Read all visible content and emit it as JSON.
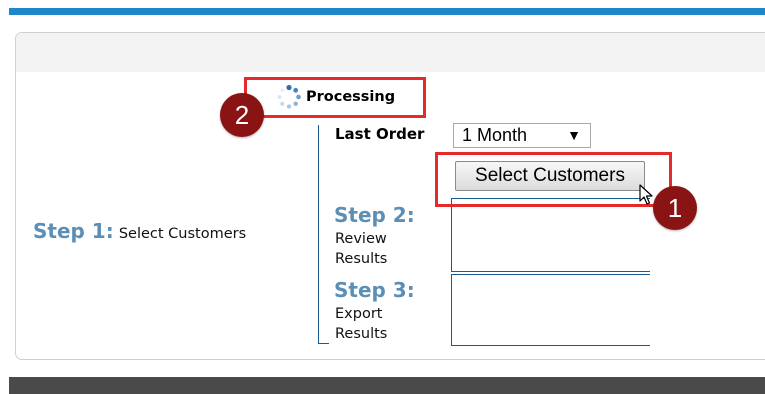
{
  "header": {
    "accent_color": "#1f87c9"
  },
  "step1": {
    "label": "Step 1:",
    "description": "Select Customers"
  },
  "processing": {
    "label": "Processing",
    "icon": "spinner-icon"
  },
  "last_order": {
    "label": "Last Order",
    "selected": "1 Month",
    "arrow": "▼"
  },
  "select_customers_button": {
    "label": "Select Customers"
  },
  "step2": {
    "label": "Step 2:",
    "line1": "Review",
    "line2": "Results"
  },
  "step3": {
    "label": "Step 3:",
    "line1": "Export",
    "line2": "Results"
  },
  "annotations": {
    "badge1": "1",
    "badge2": "2",
    "callout_color": "#e42a2a",
    "badge_color": "#8a1414"
  }
}
